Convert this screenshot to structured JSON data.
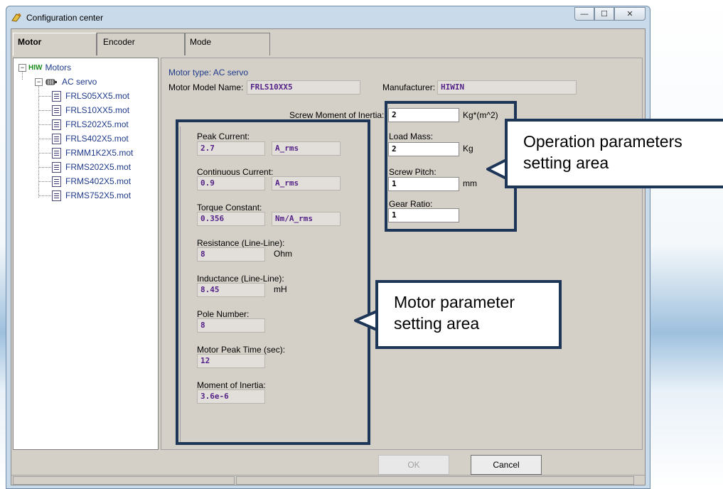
{
  "window": {
    "title": "Configuration center",
    "min_glyph": "—",
    "max_glyph": "☐",
    "close_glyph": "✕"
  },
  "tabs": [
    {
      "label": "Motor",
      "active": true
    },
    {
      "label": "Encoder",
      "active": false
    },
    {
      "label": "Mode",
      "active": false
    }
  ],
  "tree": {
    "root_logo": "HIW",
    "root_label": "Motors",
    "group_label": "AC servo",
    "files": [
      "FRLS05XX5.mot",
      "FRLS10XX5.mot",
      "FRLS202X5.mot",
      "FRLS402X5.mot",
      "FRMM1K2X5.mot",
      "FRMS202X5.mot",
      "FRMS402X5.mot",
      "FRMS752X5.mot"
    ]
  },
  "panel": {
    "motor_type": "Motor type: AC servo",
    "model_name_label": "Motor Model Name:",
    "model_name_value": "FRLS10XX5",
    "manufacturer_label": "Manufacturer:",
    "manufacturer_value": "HIWIN",
    "screw_moi_label": "Screw Moment of Inertia:",
    "screw_moi_value": "2",
    "screw_moi_unit": "Kg*(m^2)",
    "load_mass_label": "Load Mass:",
    "load_mass_value": "2",
    "load_mass_unit": "Kg",
    "screw_pitch_label": "Screw Pitch:",
    "screw_pitch_value": "1",
    "screw_pitch_unit": "mm",
    "gear_ratio_label": "Gear Ratio:",
    "gear_ratio_value": "1",
    "peak_current_label": "Peak Current:",
    "peak_current_value": "2.7",
    "peak_current_unit": "A_rms",
    "cont_current_label": "Continuous Current:",
    "cont_current_value": "0.9",
    "cont_current_unit": "A_rms",
    "torque_label": "Torque Constant:",
    "torque_value": "0.356",
    "torque_unit": "Nm/A_rms",
    "resistance_label": "Resistance (Line-Line):",
    "resistance_value": "8",
    "resistance_unit": "Ohm",
    "inductance_label": "Inductance (Line-Line):",
    "inductance_value": "8.45",
    "inductance_unit": "mH",
    "pole_label": "Pole Number:",
    "pole_value": "8",
    "peak_time_label": "Motor Peak Time (sec):",
    "peak_time_value": "12",
    "moi_label": "Moment of Inertia:",
    "moi_value": "3.6e-6"
  },
  "buttons": {
    "ok": "OK",
    "cancel": "Cancel"
  },
  "callouts": {
    "operation": "Operation parameters setting area",
    "motor": "Motor parameter setting area"
  },
  "colors": {
    "callout_border": "#1d3557",
    "value_text": "#552288",
    "tree_text": "#1f3b8a"
  }
}
